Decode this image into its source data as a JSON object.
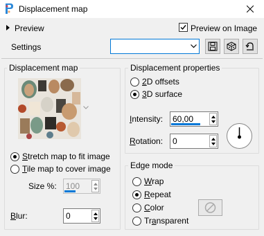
{
  "window": {
    "title": "Displacement map"
  },
  "header": {
    "preview_label": "Preview",
    "preview_on_image_label": "Preview on Image",
    "preview_on_image_checked": true,
    "settings_label": "Settings",
    "settings_value": ""
  },
  "displacement_map": {
    "title": "Displacement map",
    "stretch_label": "Stretch map to fit image",
    "tile_label": "Tile map to cover image",
    "selected": "stretch",
    "size_label": "Size %:",
    "size_value": "100",
    "blur_label": "Blur:",
    "blur_value": "0"
  },
  "displacement_properties": {
    "title": "Displacement properties",
    "offsets_2d_label": "2D offsets",
    "surface_3d_label": "3D surface",
    "selected": "3d",
    "intensity_label": "Intensity:",
    "intensity_value": "60,00",
    "rotation_label": "Rotation:",
    "rotation_value": "0"
  },
  "edge_mode": {
    "title": "Edge mode",
    "options": [
      "Wrap",
      "Repeat",
      "Color",
      "Transparent"
    ],
    "selected": "Repeat"
  },
  "colors": {
    "accent": "#0078d7",
    "window_bg": "#f0f0f0"
  }
}
